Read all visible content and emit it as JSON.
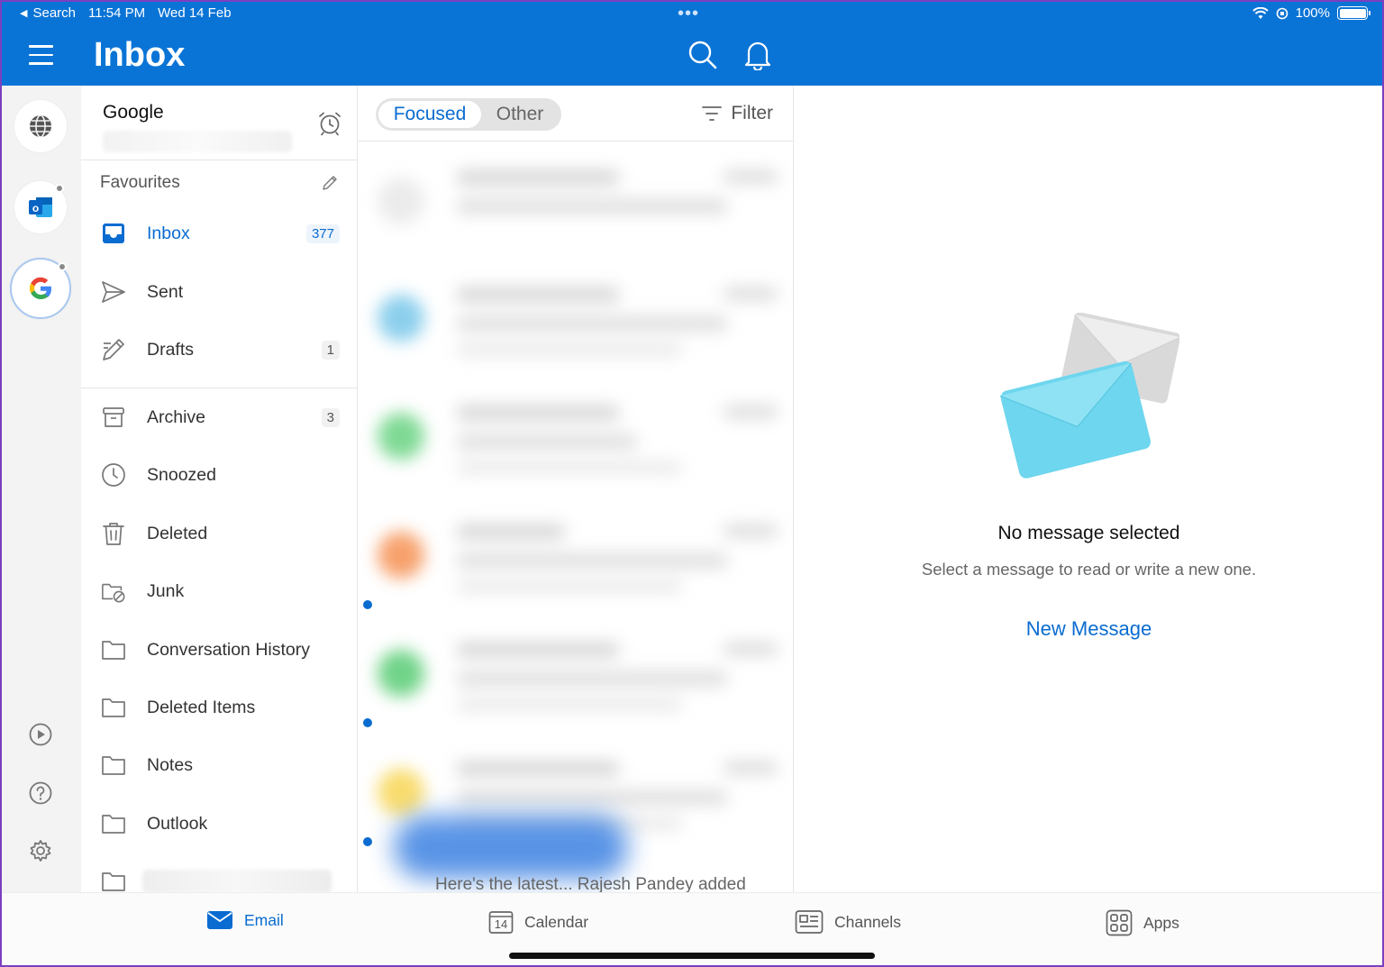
{
  "status_bar": {
    "back_label": "Search",
    "time": "11:54 PM",
    "date": "Wed 14 Feb",
    "battery": "100%"
  },
  "header": {
    "title": "Inbox"
  },
  "account": {
    "name": "Google"
  },
  "folders": {
    "favourites_label": "Favourites",
    "favourites": [
      {
        "label": "Inbox",
        "count": "377",
        "icon": "inbox-icon"
      },
      {
        "label": "Sent",
        "count": "",
        "icon": "send-icon"
      },
      {
        "label": "Drafts",
        "count": "1",
        "icon": "drafts-icon"
      }
    ],
    "all": [
      {
        "label": "Archive",
        "count": "3",
        "icon": "archive-icon"
      },
      {
        "label": "Snoozed",
        "count": "",
        "icon": "clock-icon"
      },
      {
        "label": "Deleted",
        "count": "",
        "icon": "trash-icon"
      },
      {
        "label": "Junk",
        "count": "",
        "icon": "junk-folder-icon"
      },
      {
        "label": "Conversation History",
        "count": "",
        "icon": "folder-icon"
      },
      {
        "label": "Deleted Items",
        "count": "",
        "icon": "folder-icon"
      },
      {
        "label": "Notes",
        "count": "",
        "icon": "folder-icon"
      },
      {
        "label": "Outlook",
        "count": "",
        "icon": "folder-icon"
      }
    ]
  },
  "list": {
    "tab_focused": "Focused",
    "tab_other": "Other",
    "filter_label": "Filter",
    "preview_fragment": "Here's the latest... Rajesh Pandey added"
  },
  "reading": {
    "empty_title": "No message selected",
    "empty_subtitle": "Select a message to read or write a new one.",
    "new_message_label": "New Message"
  },
  "tabbar": {
    "email": "Email",
    "calendar": "Calendar",
    "calendar_day": "14",
    "channels": "Channels",
    "apps": "Apps"
  },
  "colors": {
    "brand": "#0a74d6",
    "accent": "#0a6cd0"
  }
}
